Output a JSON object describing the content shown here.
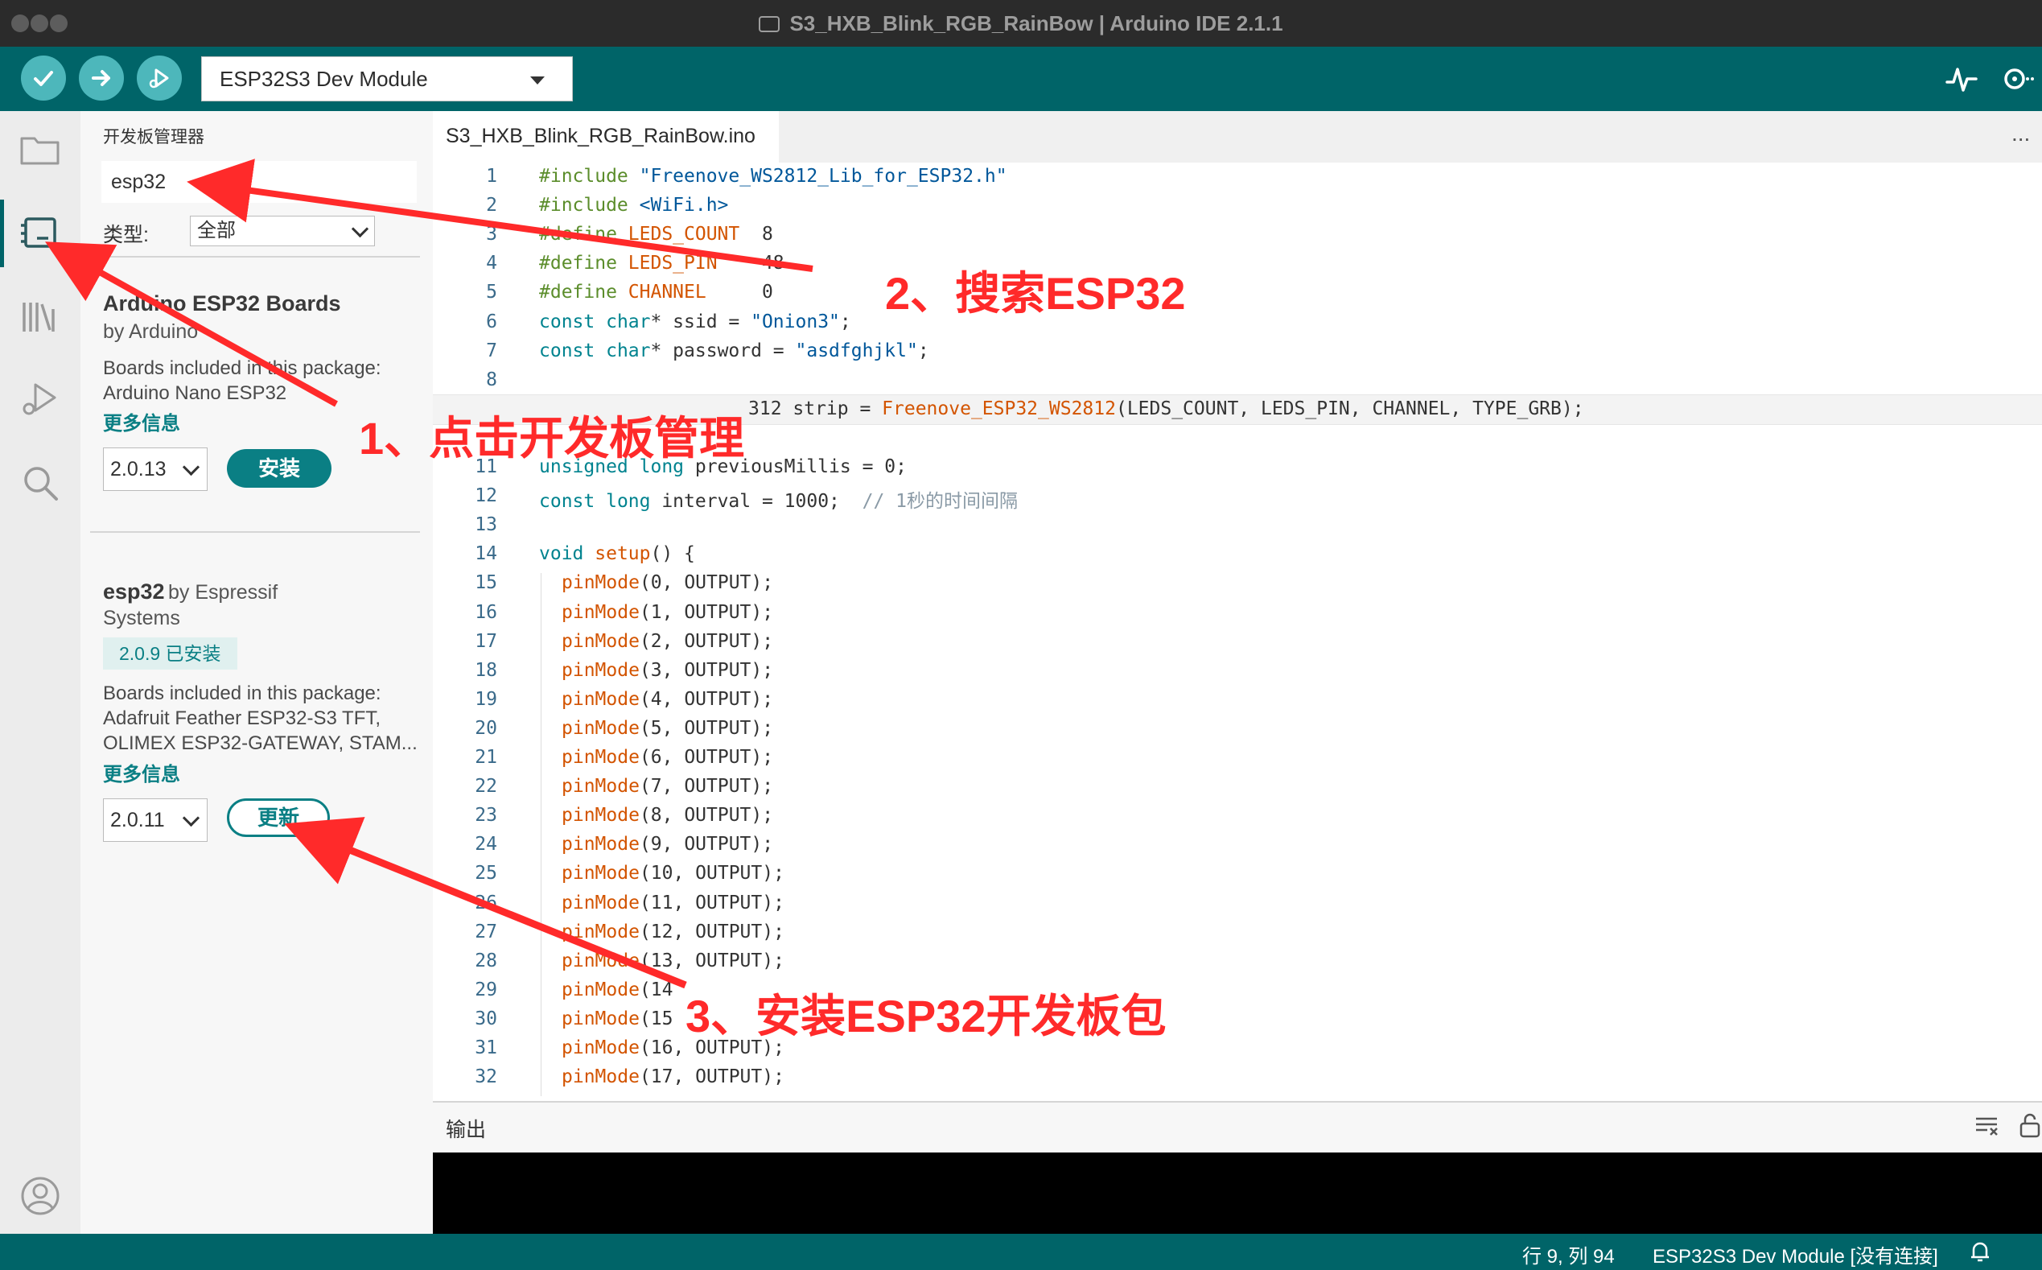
{
  "window": {
    "title": "S3_HXB_Blink_RGB_RainBow | Arduino IDE 2.1.1"
  },
  "toolbar": {
    "verify_icon": "checkmark-icon",
    "upload_icon": "arrow-right-icon",
    "debug_icon": "debug-icon",
    "board": "ESP32S3 Dev Module",
    "serial_plotter_icon": "pulse-icon",
    "serial_monitor_icon": "magnifier-icon"
  },
  "activity_bar": {
    "items": [
      "folder-icon",
      "board-manager-icon",
      "library-icon",
      "debug-icon",
      "search-icon",
      "account-icon"
    ]
  },
  "boards_manager": {
    "title": "开发板管理器",
    "search_value": "esp32",
    "type_label": "类型:",
    "type_value": "全部",
    "packages": [
      {
        "name": "Arduino ESP32 Boards",
        "by": "by Arduino",
        "included_label": "Boards included in this package:",
        "boards": "Arduino Nano ESP32",
        "more_info": "更多信息",
        "version": "2.0.13",
        "action": "安装"
      },
      {
        "name": "esp32",
        "by": "by Espressif",
        "by_line2": "Systems",
        "installed": "2.0.9 已安装",
        "included_label": "Boards included in this package:",
        "boards_line1": "Adafruit Feather ESP32-S3 TFT,",
        "boards_line2": "OLIMEX ESP32-GATEWAY, STAM...",
        "more_info": "更多信息",
        "version": "2.0.11",
        "action": "更新"
      }
    ]
  },
  "editor": {
    "tab": "S3_HXB_Blink_RGB_RainBow.ino",
    "more": "...",
    "line_numbers": [
      "1",
      "2",
      "3",
      "4",
      "5",
      "6",
      "7",
      "8",
      "11",
      "12",
      "13",
      "14",
      "15",
      "16",
      "17",
      "18",
      "19",
      "20",
      "21",
      "22",
      "23",
      "24",
      "25",
      "26",
      "27",
      "28",
      "29",
      "30",
      "31",
      "32"
    ],
    "lines": {
      "l1": [
        "#include",
        " \"Freenove_WS2812_Lib_for_ESP32.h\""
      ],
      "l2": [
        "#include",
        " <WiFi.h>"
      ],
      "l3": [
        "#define",
        " LEDS_COUNT",
        "  8"
      ],
      "l4": [
        "#define",
        " LEDS_PIN",
        "    48"
      ],
      "l5": [
        "#define",
        " CHANNEL",
        "     0"
      ],
      "l6": [
        "const ",
        "char",
        "* ssid = ",
        "\"Onion3\"",
        ";"
      ],
      "l7": [
        "const ",
        "char",
        "* password = ",
        "\"asdfghjkl\"",
        ";"
      ],
      "l9": [
        "312 strip = ",
        "Freenove_ESP32_WS2812",
        "(LEDS_COUNT, LEDS_PIN, CHANNEL, TYPE_GRB);"
      ],
      "l11": [
        "unsigned ",
        "long",
        " previousMillis = 0;"
      ],
      "l12": [
        "const ",
        "long",
        " interval = 1000;  ",
        "// 1秒的时间间隔"
      ],
      "l14": [
        "void ",
        "setup",
        "() {"
      ],
      "pinmodes": [
        [
          "pinMode",
          "(0, OUTPUT);"
        ],
        [
          "pinMode",
          "(1, OUTPUT);"
        ],
        [
          "pinMode",
          "(2, OUTPUT);"
        ],
        [
          "pinMode",
          "(3, OUTPUT);"
        ],
        [
          "pinMode",
          "(4, OUTPUT);"
        ],
        [
          "pinMode",
          "(5, OUTPUT);"
        ],
        [
          "pinMode",
          "(6, OUTPUT);"
        ],
        [
          "pinMode",
          "(7, OUTPUT);"
        ],
        [
          "pinMode",
          "(8, OUTPUT);"
        ],
        [
          "pinMode",
          "(9, OUTPUT);"
        ],
        [
          "pinMode",
          "(10, OUTPUT);"
        ],
        [
          "pinMode",
          "(11, OUTPUT);"
        ],
        [
          "pinMode",
          "(12, OUTPUT);"
        ],
        [
          "pinMode",
          "(13, OUTPUT);"
        ],
        [
          "pinMode",
          "(14"
        ],
        [
          "pinMode",
          "(15"
        ],
        [
          "pinMode",
          "(16, OUTPUT);"
        ],
        [
          "pinMode",
          "(17, OUTPUT);"
        ]
      ]
    }
  },
  "output": {
    "label": "输出"
  },
  "status": {
    "cursor": "行 9, 列 94",
    "board": "ESP32S3 Dev Module [没有连接]",
    "bell_icon": "bell-icon"
  },
  "annotations": {
    "step1": "1、点击开发板管理",
    "step2": "2、搜索ESP32",
    "step3": "3、安装ESP32开发板包",
    "color": "#ff2a2a"
  }
}
